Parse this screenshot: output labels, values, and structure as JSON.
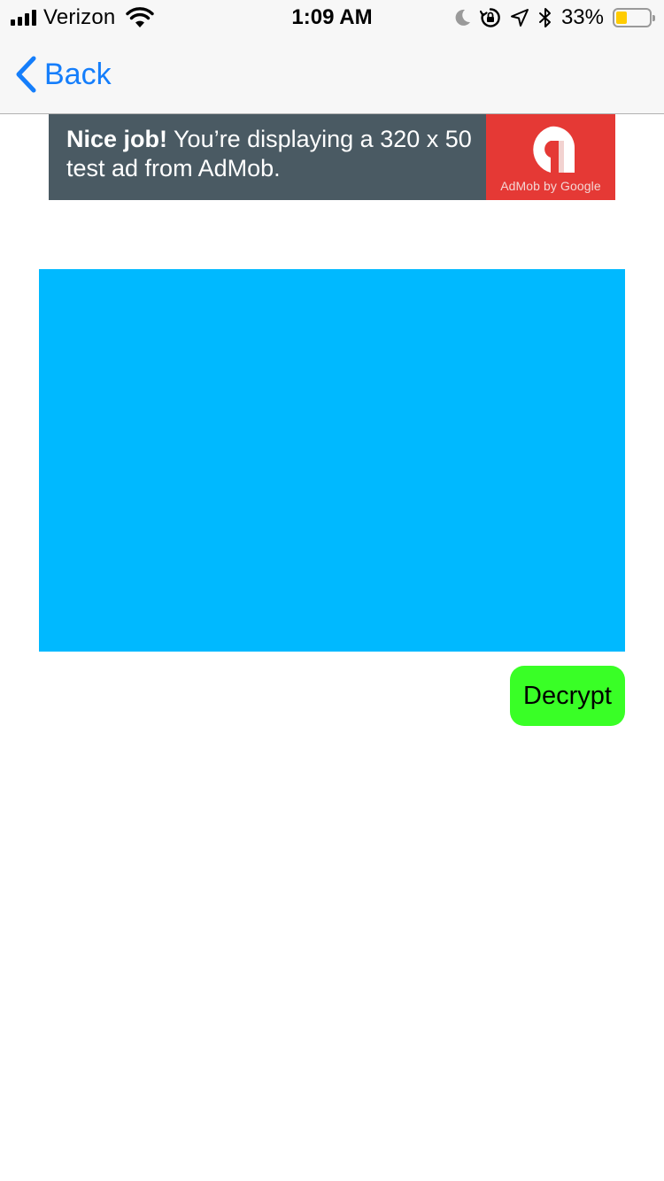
{
  "status_bar": {
    "carrier": "Verizon",
    "time": "1:09 AM",
    "battery_percent": "33%",
    "battery_level": 0.33,
    "battery_color": "#ffcc00",
    "icons": [
      "signal-bars-icon",
      "wifi-icon",
      "moon-icon",
      "orientation-lock-icon",
      "location-arrow-icon",
      "bluetooth-icon",
      "battery-icon"
    ]
  },
  "nav": {
    "back_label": "Back",
    "tint_color": "#157efb",
    "back_icon": "chevron-left-icon"
  },
  "ad": {
    "headline": "Nice job!",
    "body": " You’re displaying a 320 x 50 test ad from AdMob.",
    "logo_caption": "AdMob by Google",
    "background_color": "#4a5a63",
    "logo_background_color": "#e53935",
    "logo_icon": "admob-logo-icon"
  },
  "content": {
    "panel_color": "#00b9ff",
    "decrypt_label": "Decrypt",
    "decrypt_color": "#39ff26"
  }
}
